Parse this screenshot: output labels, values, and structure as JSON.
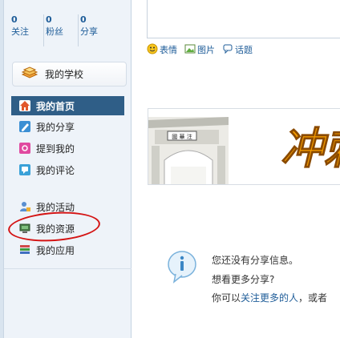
{
  "stats": [
    {
      "count": "0",
      "label": "关注"
    },
    {
      "count": "0",
      "label": "粉丝"
    },
    {
      "count": "0",
      "label": "分享"
    }
  ],
  "school_button": {
    "label": "我的学校",
    "icon": "book-stack-icon"
  },
  "nav": [
    {
      "label": "我的首页",
      "icon": "home-icon",
      "active": true
    },
    {
      "label": "我的分享",
      "icon": "share-pencil-icon"
    },
    {
      "label": "提到我的",
      "icon": "mention-icon"
    },
    {
      "label": "我的评论",
      "icon": "comment-icon"
    },
    {
      "label": "我的活动",
      "icon": "activity-person-icon"
    },
    {
      "label": "我的资源",
      "icon": "resource-monitor-icon"
    },
    {
      "label": "我的应用",
      "icon": "apps-stack-icon"
    }
  ],
  "toolbar": [
    {
      "label": "表情",
      "icon": "smiley-icon"
    },
    {
      "label": "图片",
      "icon": "picture-icon"
    },
    {
      "label": "话题",
      "icon": "topic-bubble-icon"
    }
  ],
  "banner": {
    "plaque": "國 華 注",
    "slogan": "冲刺"
  },
  "empty_message": {
    "line1": "您还没有分享信息。",
    "line2": "想看更多分享?",
    "line3_prefix": "你可以",
    "line3_link": "关注更多的人",
    "line3_suffix": "，或者"
  },
  "colors": {
    "accent": "#2f5e87",
    "link": "#1f5d99",
    "highlight_ring": "#d41414",
    "slogan": "#f29a00"
  }
}
